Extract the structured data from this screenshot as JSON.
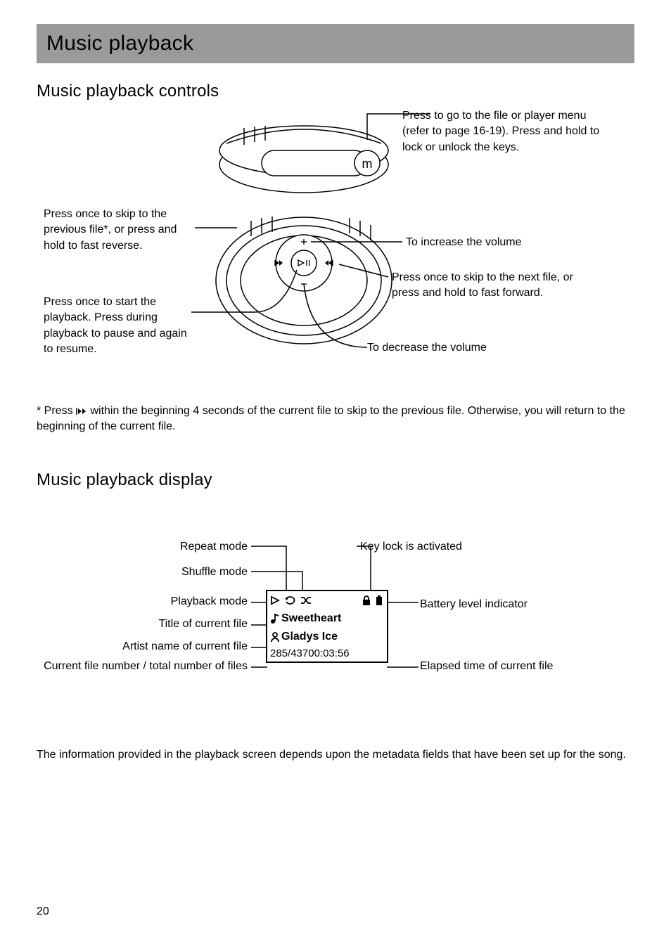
{
  "banner": {
    "title": "Music playback"
  },
  "section_controls": {
    "heading": "Music playback controls"
  },
  "controls": {
    "menu_label": "m",
    "callouts": {
      "menu": "Press to go to the file or player menu (refer to page 16-19). Press and hold to lock or unlock the keys.",
      "prev": "Press once to skip to the previous file*, or press and hold to fast reverse.",
      "play": "Press once to start the playback. Press during playback to pause and again to resume.",
      "vol_up": "To increase the volume",
      "next": "Press once to skip to the next file, or press and hold to fast forward.",
      "vol_down": "To decrease the volume"
    }
  },
  "footnote": "* Press ⏮ within the beginning 4 seconds of the current file to skip to the previous file. Otherwise, you will return to the beginning of the current file.",
  "section_display": {
    "heading": "Music playback display"
  },
  "display": {
    "labels": {
      "repeat": "Repeat mode",
      "shuffle": "Shuffle mode",
      "playback": "Playback mode",
      "title": "Title of current file",
      "artist": "Artist name of current file",
      "filecount": "Current file number / total number of files",
      "keylock": "Key lock is activated",
      "battery": "Battery level indicator",
      "elapsed": "Elapsed time of current file"
    },
    "screen": {
      "title": "Sweetheart",
      "artist": "Gladys Ice",
      "file_count": "285/437",
      "elapsed": "00:03:56"
    }
  },
  "closing_para": "The information provided in the playback screen depends upon the metadata fields that have been set up for the song.",
  "page_number": "20"
}
